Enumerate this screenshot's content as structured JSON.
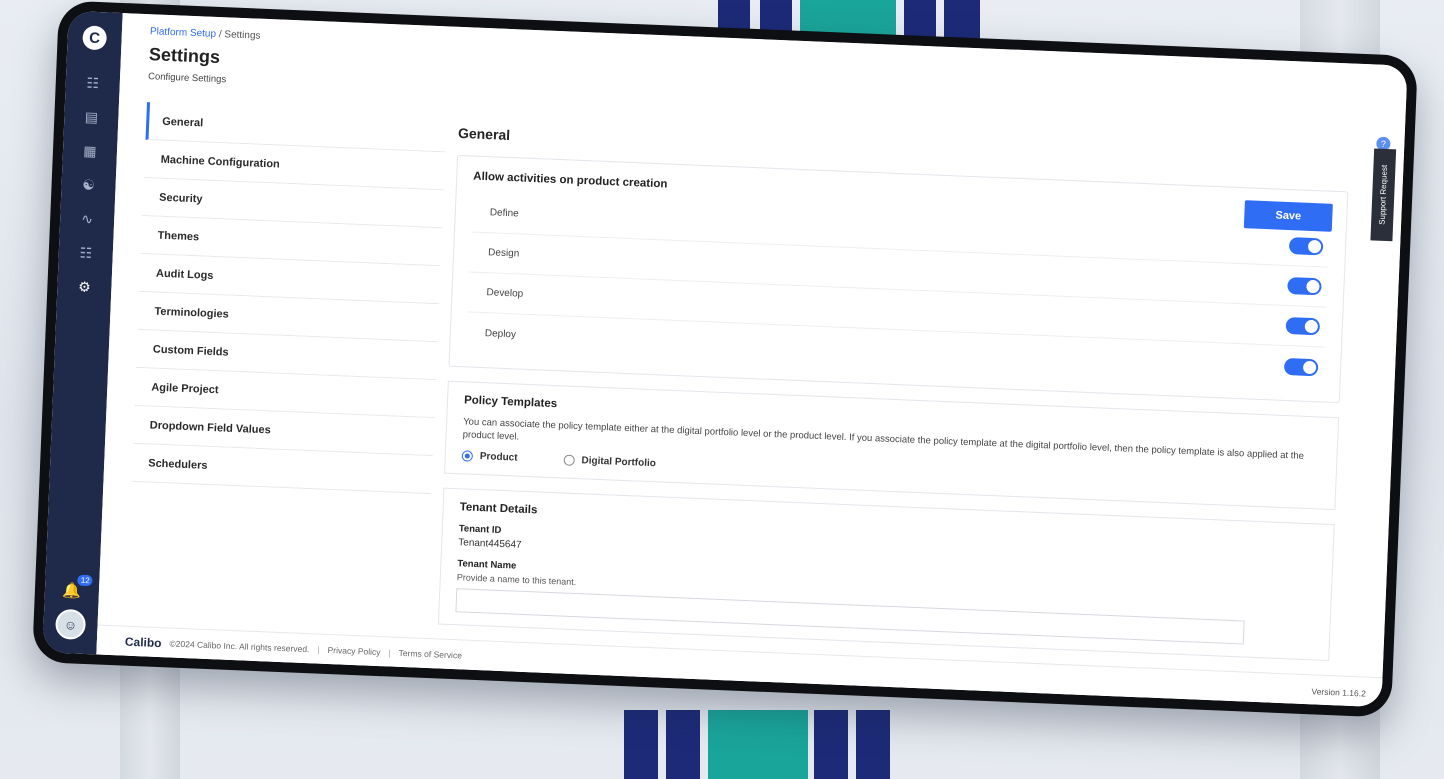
{
  "breadcrumb": {
    "parent": "Platform Setup",
    "separator": "/",
    "current": "Settings"
  },
  "page": {
    "title": "Settings",
    "subtitle": "Configure Settings"
  },
  "rail": {
    "notifications_count": "12",
    "icons": [
      "apps-icon",
      "briefcase-icon",
      "board-icon",
      "people-icon",
      "chart-icon",
      "org-icon",
      "gear-icon"
    ]
  },
  "settings_nav": [
    {
      "label": "General",
      "active": true
    },
    {
      "label": "Machine Configuration"
    },
    {
      "label": "Security"
    },
    {
      "label": "Themes"
    },
    {
      "label": "Audit Logs"
    },
    {
      "label": "Terminologies"
    },
    {
      "label": "Custom Fields"
    },
    {
      "label": "Agile Project"
    },
    {
      "label": "Dropdown Field Values"
    },
    {
      "label": "Schedulers"
    }
  ],
  "general": {
    "heading": "General",
    "activities_title": "Allow activities on product creation",
    "save_label": "Save",
    "activities": [
      {
        "label": "Define",
        "enabled": true
      },
      {
        "label": "Design",
        "enabled": true
      },
      {
        "label": "Develop",
        "enabled": true
      },
      {
        "label": "Deploy",
        "enabled": true
      }
    ]
  },
  "policy": {
    "title": "Policy Templates",
    "description": "You can associate the policy template either at the digital portfolio level or the product level. If you associate the policy template at the digital portfolio level, then the policy template is also applied at the product level.",
    "options": [
      {
        "label": "Product",
        "checked": true
      },
      {
        "label": "Digital Portfolio",
        "checked": false
      }
    ]
  },
  "tenant": {
    "title": "Tenant Details",
    "id_label": "Tenant ID",
    "id_value": "Tenant445647",
    "name_label": "Tenant Name",
    "name_hint": "Provide a name to this tenant."
  },
  "support_tab": "Support Request",
  "footer": {
    "brand": "Calibo",
    "copyright": "©2024 Calibo Inc. All rights reserved.",
    "privacy": "Privacy Policy",
    "terms": "Terms of Service",
    "version": "Version 1.16.2"
  },
  "colors": {
    "accent": "#2f6df5",
    "rail": "#1f2a4a",
    "stripe_navy": "#1c2a78",
    "stripe_teal": "#1aa59a"
  }
}
